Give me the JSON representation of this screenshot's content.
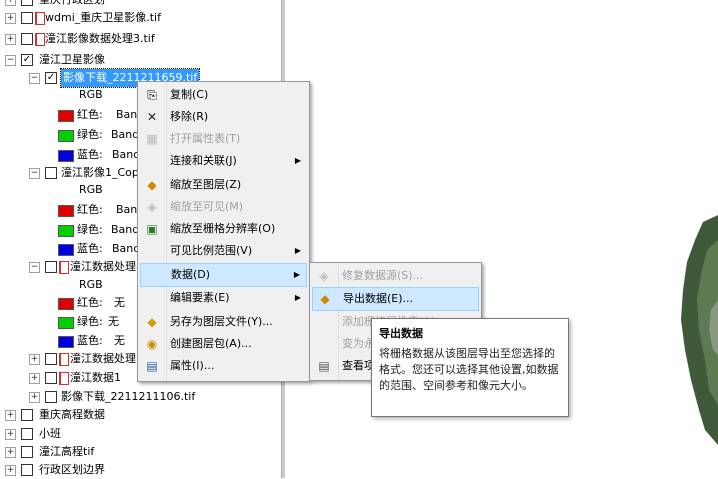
{
  "toc": {
    "rows": [
      {
        "label": "重庆行政区划",
        "expander": "+",
        "checked": false,
        "icon": "none"
      },
      {
        "label": "wdmi_重庆卫星影像.tif",
        "expander": "+",
        "checked": false,
        "icon": "raster-layer"
      },
      {
        "label": "潼江影像数据处理3.tif",
        "expander": "+",
        "checked": false,
        "icon": "raster-layer"
      },
      {
        "label": "潼江卫星影像",
        "expander": "-",
        "checked": true,
        "icon": "none"
      },
      {
        "label": "影像下载_2211211659.tif",
        "expander": "-",
        "checked": true,
        "icon": "none",
        "selected": true
      },
      {
        "label": "RGB"
      },
      {
        "label": "红色:",
        "band": "Ban",
        "swatch": "#e00000"
      },
      {
        "label": "绿色:",
        "band": "Band_",
        "swatch": "#00d000"
      },
      {
        "label": "蓝色:",
        "band": "Banc",
        "swatch": "#0000e0"
      },
      {
        "label": "潼江影像1_Cop",
        "expander": "-",
        "checked": false,
        "icon": "none"
      },
      {
        "label": "RGB"
      },
      {
        "label": "红色:",
        "band": "Ban",
        "swatch": "#e00000"
      },
      {
        "label": "绿色:",
        "band": "Band_",
        "swatch": "#00d000"
      },
      {
        "label": "蓝色:",
        "band": "Banc",
        "swatch": "#0000e0"
      },
      {
        "label": "潼江数据处理8",
        "expander": "-",
        "checked": false,
        "icon": "raster-layer"
      },
      {
        "label": "RGB"
      },
      {
        "label": "红色:",
        "band": "无",
        "swatch": "#e00000"
      },
      {
        "label": "绿色:",
        "band": "无",
        "swatch": "#00d000"
      },
      {
        "label": "蓝色:",
        "band": "无",
        "swatch": "#0000e0"
      },
      {
        "label": "潼江数据处理1",
        "expander": "+",
        "checked": false,
        "icon": "raster-layer"
      },
      {
        "label": "潼江数据1",
        "expander": "+",
        "checked": false,
        "icon": "raster-layer"
      },
      {
        "label": "影像下载_2211211106.tif",
        "expander": "+",
        "checked": false,
        "icon": "none"
      },
      {
        "label": "重庆高程数据",
        "expander": "+",
        "checked": false,
        "icon": "none"
      },
      {
        "label": "小班",
        "expander": "+",
        "checked": false,
        "icon": "none"
      },
      {
        "label": "潼江高程tif",
        "expander": "+",
        "checked": false,
        "icon": "none"
      },
      {
        "label": "行政区划边界",
        "expander": "+",
        "checked": false,
        "icon": "none"
      }
    ]
  },
  "context_menu": {
    "items": [
      {
        "label": "复制(C)",
        "icon": "copy-icon",
        "enabled": true
      },
      {
        "label": "移除(R)",
        "icon": "remove-icon",
        "enabled": true
      },
      {
        "label": "打开属性表(T)",
        "icon": "table-icon",
        "enabled": false
      },
      {
        "label": "连接和关联(J)",
        "icon": "",
        "enabled": true,
        "submenu": true
      },
      {
        "label": "缩放至图层(Z)",
        "icon": "zoom-layer-icon",
        "enabled": true
      },
      {
        "label": "缩放至可见(M)",
        "icon": "zoom-visible-icon",
        "enabled": false
      },
      {
        "label": "缩放至栅格分辨率(O)",
        "icon": "zoom-raster-icon",
        "enabled": true
      },
      {
        "label": "可见比例范围(V)",
        "icon": "",
        "enabled": true,
        "submenu": true
      },
      {
        "label": "数据(D)",
        "icon": "",
        "enabled": true,
        "submenu": true,
        "highlighted": true
      },
      {
        "label": "编辑要素(E)",
        "icon": "",
        "enabled": true,
        "submenu": true
      },
      {
        "label": "另存为图层文件(Y)...",
        "icon": "layer-file-icon",
        "enabled": true
      },
      {
        "label": "创建图层包(A)...",
        "icon": "layer-package-icon",
        "enabled": true
      },
      {
        "label": "属性(I)...",
        "icon": "properties-icon",
        "enabled": true
      }
    ]
  },
  "data_submenu": {
    "items": [
      {
        "label": "修复数据源(S)...",
        "icon": "repair-icon",
        "enabled": false
      },
      {
        "label": "导出数据(E)...",
        "icon": "export-icon",
        "enabled": true,
        "highlighted": true
      },
      {
        "label": "添加栅格属性表(A)",
        "enabled": false
      },
      {
        "label": "变为永久图层(M)",
        "enabled": false
      },
      {
        "label": "查看项目描述(V)",
        "icon": "metadata-icon",
        "enabled": true
      }
    ]
  },
  "tooltip": {
    "title": "导出数据",
    "body": "将栅格数据从该图层导出至您选择的格式。您还可以选择其他设置,如数据的范围、空间参考和像元大小。"
  },
  "colors": {
    "selection": "#3399ff",
    "menu_highlight": "#cde8ff",
    "menu_bg": "#f0f0f0"
  }
}
